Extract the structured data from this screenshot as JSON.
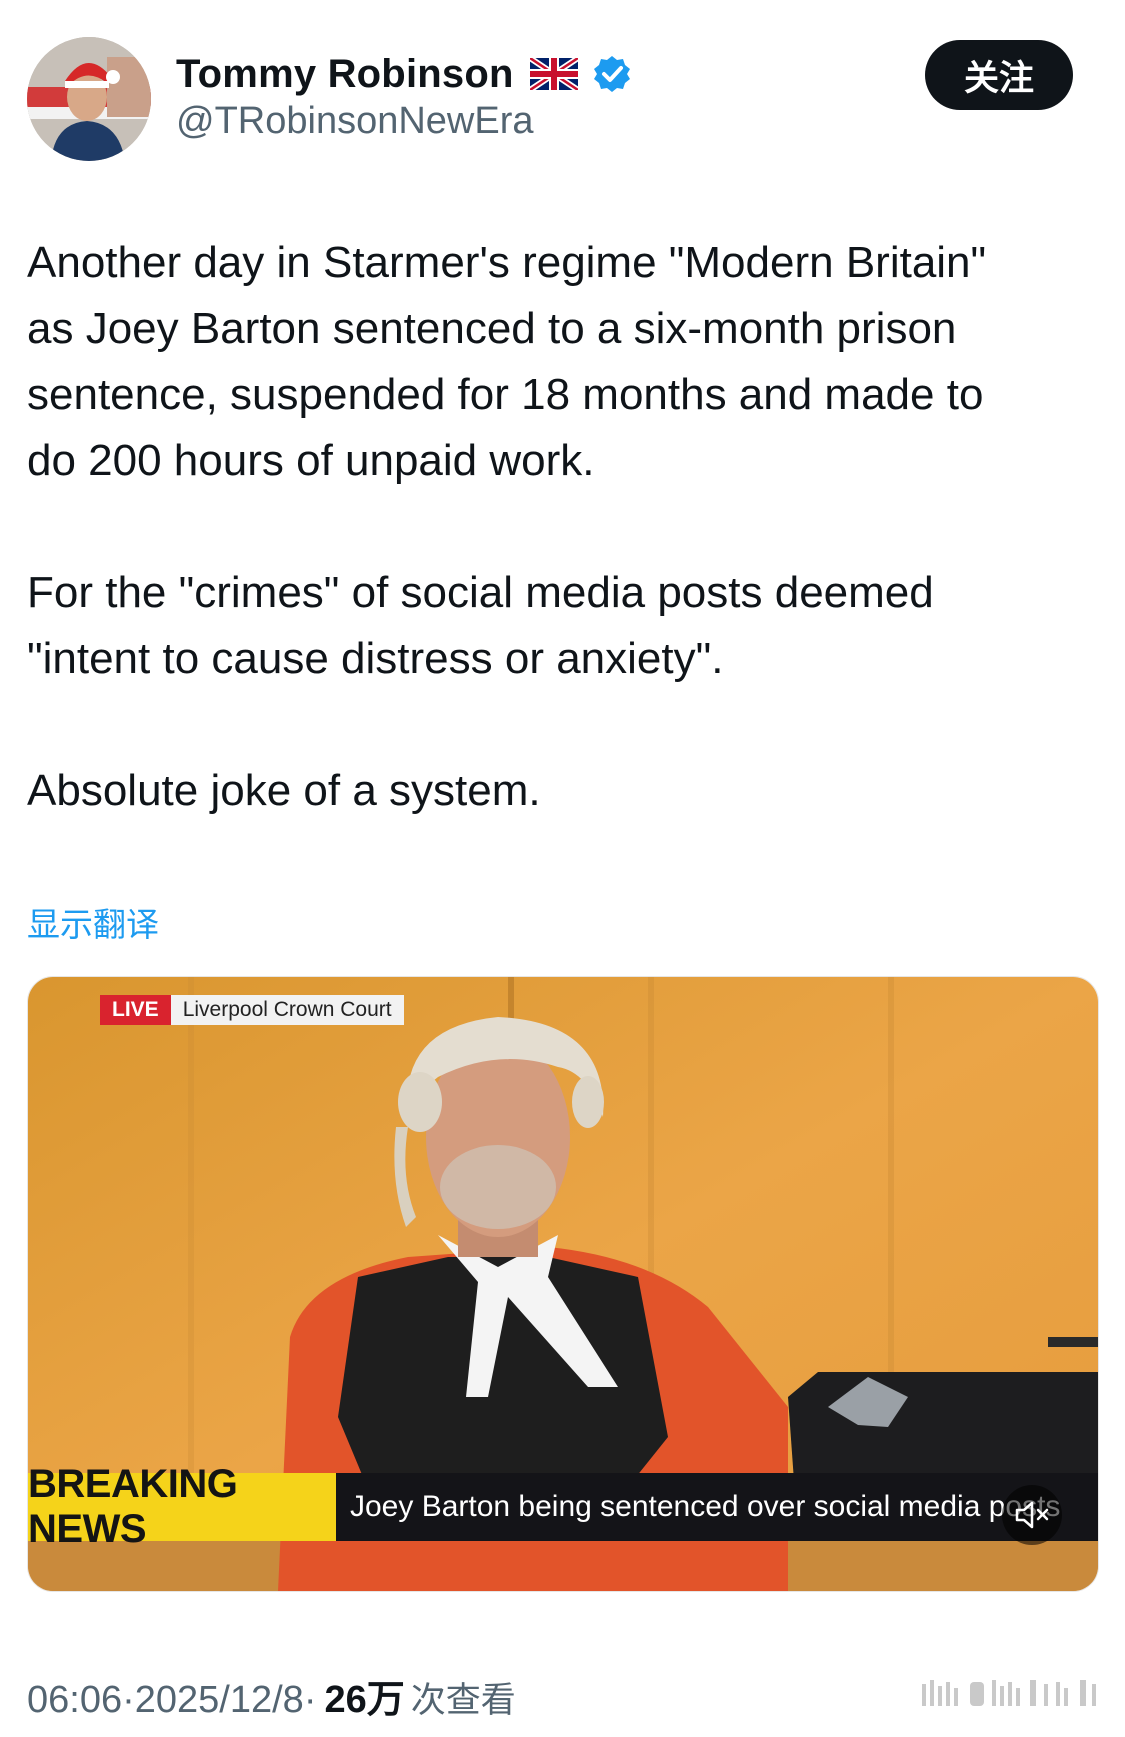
{
  "author": {
    "name": "Tommy Robinson",
    "handle": "@TRobinsonNewEra",
    "flag_icon": "uk-flag-icon",
    "verified_icon": "verified-badge-icon",
    "verified_color": "#1d9bf0"
  },
  "follow_button": {
    "label": "关注"
  },
  "tweet": {
    "paragraphs": [
      "Another day in Starmer's regime \"Modern Britain\"\nas Joey Barton sentenced to a six-month prison\nsentence, suspended for 18 months and made to\ndo 200 hours of unpaid work.",
      "For the \"crimes\" of social media posts deemed\n\"intent to cause distress or anxiety\".",
      "Absolute joke of a system."
    ],
    "translate_label": "显示翻译"
  },
  "media": {
    "live_label": "LIVE",
    "location": "Liverpool Crown Court",
    "breaking_label": "BREAKING NEWS",
    "headline": "Joey Barton being sentenced over social media posts",
    "mute_icon": "speaker-muted-icon"
  },
  "meta": {
    "time": "06:06",
    "separator": " · ",
    "date": "2025/12/8",
    "views": "26万",
    "views_label": "次查看"
  },
  "colors": {
    "accent": "#1d9bf0",
    "text": "#0f1419",
    "secondary": "#536471",
    "breaking_yellow": "#f5d31a",
    "live_red": "#d9232e"
  }
}
